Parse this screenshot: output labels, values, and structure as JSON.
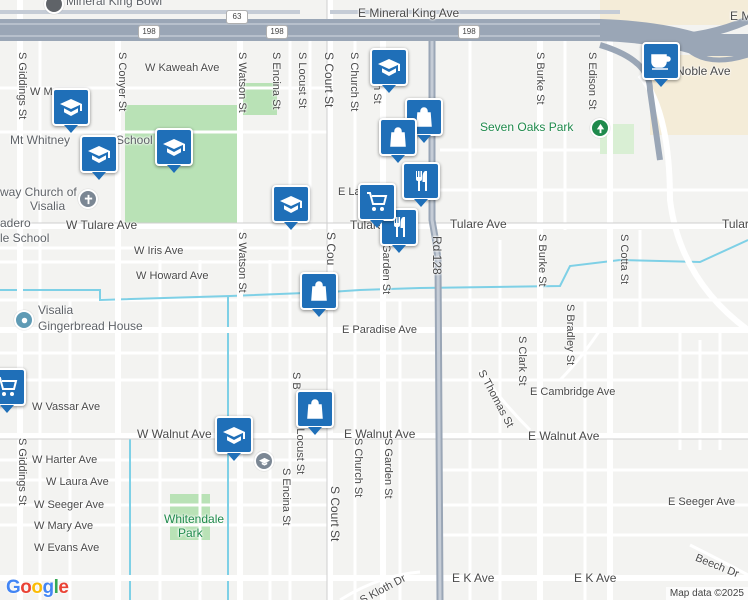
{
  "map": {
    "streets": {
      "mineral_king": "E Mineral King Ave",
      "kaweah": "W Kaweah Ave",
      "noble": "Noble Ave",
      "tulare_w": "W Tulare Ave",
      "tulare_mid": "Tulare Ave",
      "tulare_e": "Tulare",
      "tulare_part": "Tulare",
      "iris": "W Iris Ave",
      "howard": "W Howard Ave",
      "paradise": "E Paradise Ave",
      "cambridge": "E Cambridge Ave",
      "vassar": "W Vassar Ave",
      "walnut_w": "W Walnut Ave",
      "walnut_e1": "E Walnut Ave",
      "walnut_e2": "E Walnut Ave",
      "harter": "W Harter Ave",
      "laura": "W Laura Ave",
      "seeger_w": "W Seeger Ave",
      "seeger_e": "E Seeger Ave",
      "mary": "W Mary Ave",
      "evans": "W Evans Ave",
      "k_ave1": "E K Ave",
      "k_ave2": "E K Ave",
      "beech": "Beech Dr",
      "kloth": "S Kloth Dr",
      "e_la": "E La",
      "e_m": "E M",
      "w_m": "W M",
      "giddings": "S Giddings St",
      "giddings2": "S Giddings St",
      "conyer": "S Conyer St",
      "watson": "S Watson St",
      "watson2": "S Watson St",
      "encina": "S Encina St",
      "encina2": "S Encina St",
      "locust": "S Locust St",
      "locust2": "S Locust St",
      "court": "S Court St",
      "court2": "S Cou",
      "court3": "S Court St",
      "church": "S Church St",
      "church2": "S Church St",
      "garden": "Garden St",
      "garden2": "S Garden St",
      "garden_n": "en St",
      "rd128": "Rd 128",
      "burke": "S Burke St",
      "burke2": "S Burke St",
      "edison": "S Edison St",
      "cotta": "S Cotta St",
      "bradley": "S Bradley St",
      "clark": "S Clark St",
      "thomas": "S Thomas St",
      "sb": "S B"
    },
    "highway_shields": {
      "h63": "63",
      "h198a": "198",
      "h198b": "198",
      "h198c": "198"
    },
    "pois": {
      "mineral_king_bowl": "Mineral King Bowl",
      "mt_whitney": "Mt Whitney",
      "school_suffix": "School",
      "church_line1": "way Church of",
      "church_line2": "Visalia",
      "cadero": "adero",
      "middle_school": "le School",
      "visalia_gb_1": "Visalia",
      "visalia_gb_2": "Gingerbread House",
      "seven_oaks": "Seven Oaks Park",
      "whitendale_1": "Whitendale",
      "whitendale_2": "Park"
    },
    "markers": [
      {
        "kind": "school-icon"
      },
      {
        "kind": "school-icon"
      },
      {
        "kind": "school-icon"
      },
      {
        "kind": "school-icon"
      },
      {
        "kind": "school-icon"
      },
      {
        "kind": "school-icon"
      },
      {
        "kind": "shopping-bag-icon"
      },
      {
        "kind": "shopping-bag-icon"
      },
      {
        "kind": "shopping-bag-icon"
      },
      {
        "kind": "shopping-bag-icon"
      },
      {
        "kind": "restaurant-icon"
      },
      {
        "kind": "restaurant-icon"
      },
      {
        "kind": "shopping-cart-icon"
      },
      {
        "kind": "shopping-cart-icon"
      },
      {
        "kind": "cafe-icon"
      }
    ],
    "logo": "Google",
    "attribution": "Map data ©2025",
    "colors": {
      "marker": "#1f6fb8",
      "water": "#7ed0e6",
      "highway": "#9aa6b6",
      "park": "#b9e2b6",
      "poi_park": "#1f8a4c"
    }
  }
}
